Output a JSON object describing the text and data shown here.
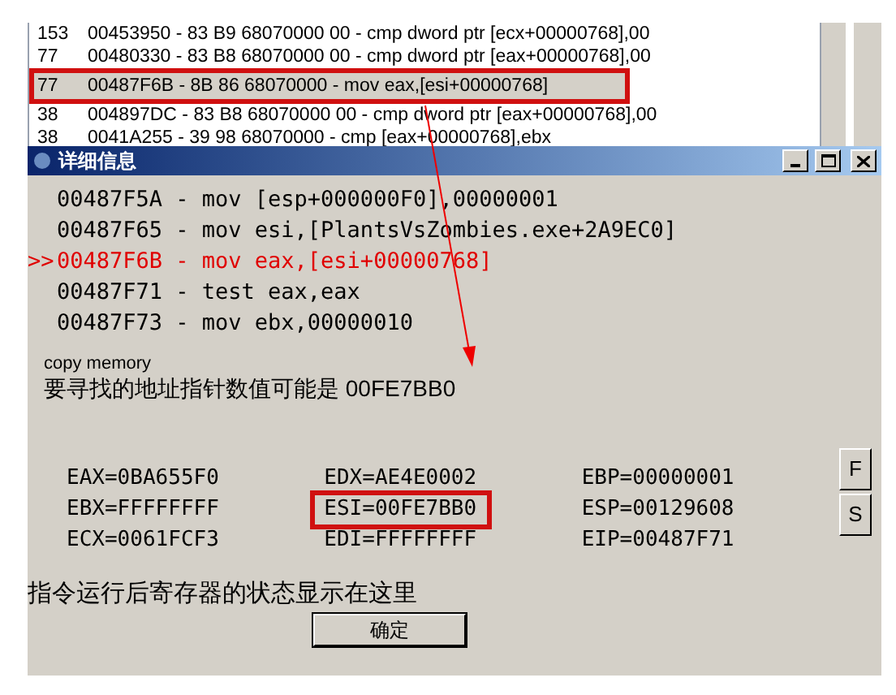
{
  "process_list": {
    "rows": [
      {
        "count": "153",
        "text": "00453950 - 83 B9 68070000 00 - cmp dword ptr [ecx+00000768],00",
        "selected": false,
        "annotated": false
      },
      {
        "count": "77",
        "text": "00480330 - 83 B8 68070000 00 - cmp dword ptr [eax+00000768],00",
        "selected": false,
        "annotated": false
      },
      {
        "count": "77",
        "text": "00487F6B - 8B 86 68070000 - mov eax,[esi+00000768]",
        "selected": true,
        "annotated": true
      },
      {
        "count": "38",
        "text": "004897DC - 83 B8 68070000 00 - cmp dword ptr [eax+00000768],00",
        "selected": false,
        "annotated": false
      },
      {
        "count": "38",
        "text": "0041A255 - 39 98 68070000 - cmp [eax+00000768],ebx",
        "selected": false,
        "annotated": false
      }
    ]
  },
  "dialog": {
    "title": "详细信息",
    "code_lines": [
      {
        "text": "00487F5A - mov [esp+000000F0],00000001",
        "current": false
      },
      {
        "text": "00487F65 - mov esi,[PlantsVsZombies.exe+2A9EC0]",
        "current": false
      },
      {
        "marker": ">>",
        "text": "00487F6B - mov eax,[esi+00000768]",
        "current": true
      },
      {
        "text": "00487F71 - test eax,eax",
        "current": false
      },
      {
        "text": "00487F73 - mov ebx,00000010",
        "current": false
      }
    ],
    "copy_label": "copy memory",
    "note": "要寻找的地址指针数值可能是 00FE7BB0",
    "registers": [
      {
        "text": "EAX=0BA655F0",
        "annotated": false
      },
      {
        "text": "EDX=AE4E0002",
        "annotated": false
      },
      {
        "text": "EBP=00000001",
        "annotated": false
      },
      {
        "text": "EBX=FFFFFFFF",
        "annotated": false
      },
      {
        "text": "ESI=00FE7BB0",
        "annotated": true
      },
      {
        "text": "ESP=00129608",
        "annotated": false
      },
      {
        "text": "ECX=0061FCF3",
        "annotated": false
      },
      {
        "text": "EDI=FFFFFFFF",
        "annotated": false
      },
      {
        "text": "EIP=00487F71",
        "annotated": false
      }
    ],
    "side_buttons": [
      "F",
      "S"
    ],
    "status_text": "指令运行后寄存器的状态显示在这里",
    "ok_button": "确定"
  }
}
